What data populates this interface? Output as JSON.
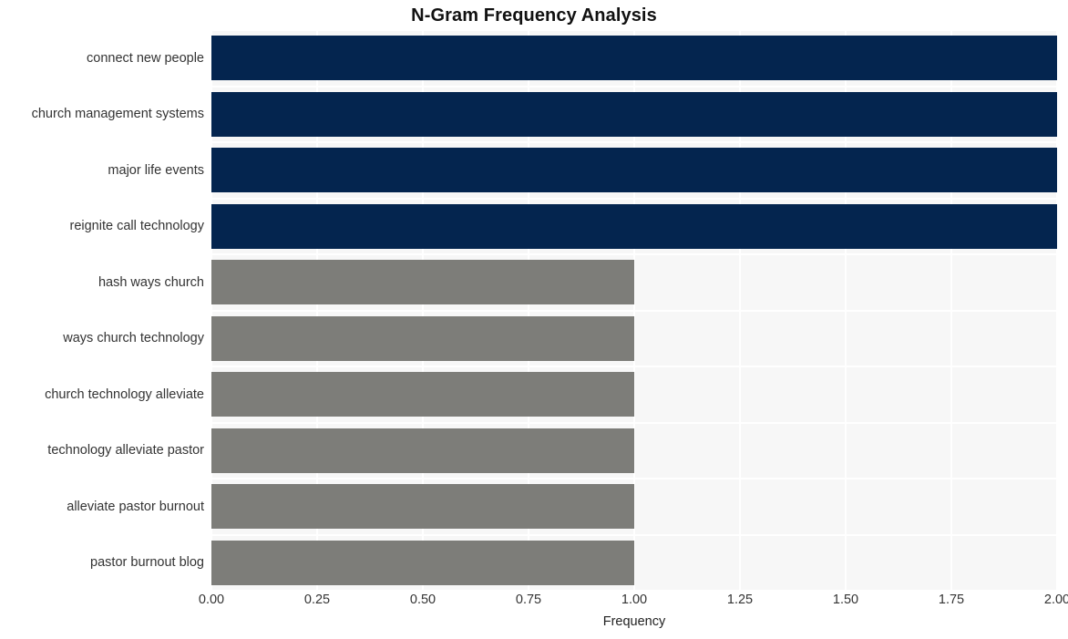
{
  "chart_data": {
    "type": "bar",
    "orientation": "horizontal",
    "title": "N-Gram Frequency Analysis",
    "xlabel": "Frequency",
    "ylabel": "",
    "xlim": [
      0,
      2
    ],
    "ylim": [
      0,
      10
    ],
    "grid": true,
    "legend": null,
    "xticks": [
      "0.00",
      "0.25",
      "0.50",
      "0.75",
      "1.00",
      "1.25",
      "1.50",
      "1.75",
      "2.00"
    ],
    "xtick_values": [
      0,
      0.25,
      0.5,
      0.75,
      1.0,
      1.25,
      1.5,
      1.75,
      2.0
    ],
    "categories": [
      "connect new people",
      "church management systems",
      "major life events",
      "reignite call technology",
      "hash ways church",
      "ways church technology",
      "church technology alleviate",
      "technology alleviate pastor",
      "alleviate pastor burnout",
      "pastor burnout blog"
    ],
    "values": [
      2,
      2,
      2,
      2,
      1,
      1,
      1,
      1,
      1,
      1
    ],
    "bar_colors": [
      "#04254f",
      "#04254f",
      "#04254f",
      "#04254f",
      "#7d7d79",
      "#7d7d79",
      "#7d7d79",
      "#7d7d79",
      "#7d7d79",
      "#7d7d79"
    ],
    "colors": {
      "highlight": "#04254f",
      "normal": "#7d7d79",
      "plot_background": "#f7f7f7",
      "figure_background": "#ffffff",
      "gridline": "#ffffff",
      "text": "#333333",
      "title_text": "#111111"
    }
  }
}
